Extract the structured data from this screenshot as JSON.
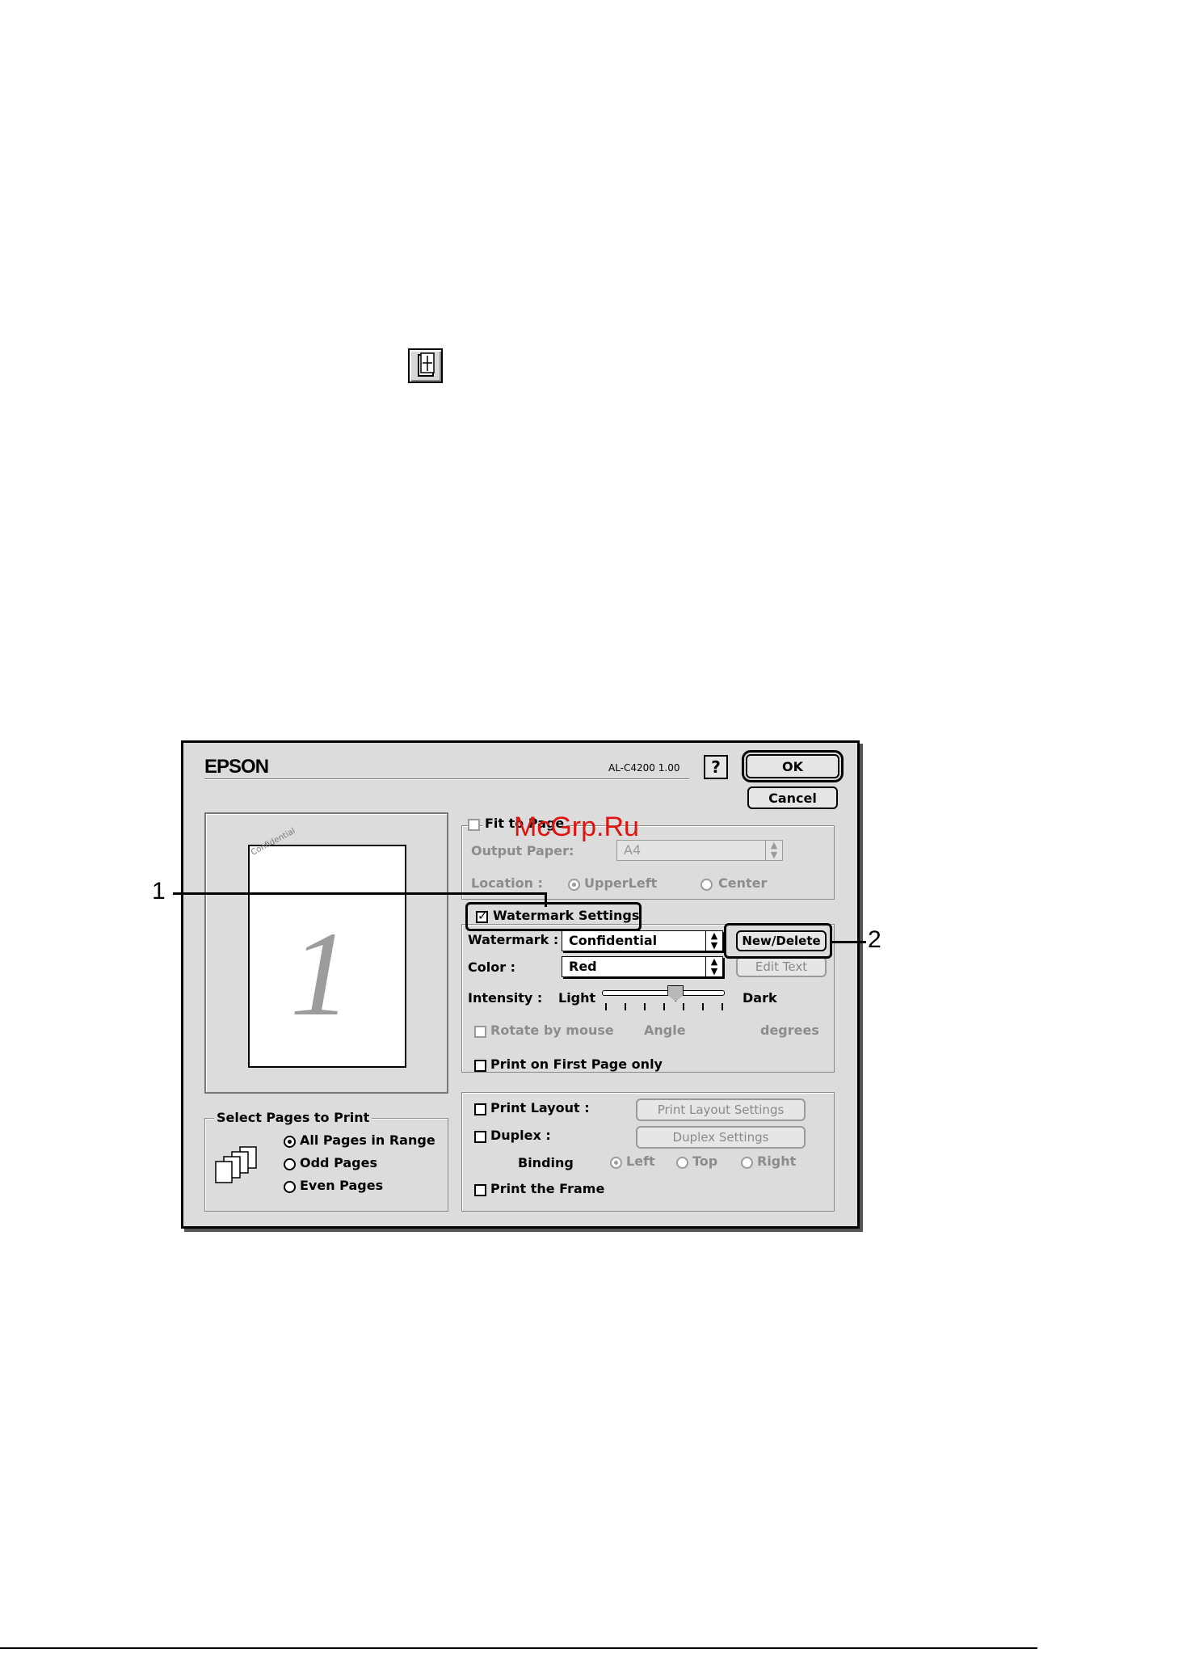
{
  "dialog": {
    "brand": "EPSON",
    "model": "AL-C4200 1.00",
    "help_label": "?",
    "ok_label": "OK",
    "cancel_label": "Cancel"
  },
  "preview": {
    "page_number": "1",
    "watermark_sample": "Confidential"
  },
  "fit_to_page": {
    "checkbox_label": "Fit to Page",
    "output_paper_label": "Output Paper:",
    "output_paper_value": "A4",
    "location_label": "Location :",
    "location_options": [
      "UpperLeft",
      "Center"
    ],
    "location_selected": "UpperLeft"
  },
  "watermark": {
    "checkbox_label": "Watermark Settings",
    "checked": true,
    "watermark_label": "Watermark :",
    "watermark_value": "Confidential",
    "new_delete_label": "New/Delete",
    "color_label": "Color :",
    "color_value": "Red",
    "edit_text_label": "Edit Text",
    "intensity_label": "Intensity :",
    "intensity_light": "Light",
    "intensity_dark": "Dark",
    "intensity_level": 0.6,
    "rotate_label": "Rotate by mouse",
    "angle_label": "Angle",
    "degrees_label": "degrees",
    "first_page_label": "Print on First Page only"
  },
  "layout": {
    "print_layout_label": "Print Layout :",
    "print_layout_settings_label": "Print Layout Settings",
    "duplex_label": "Duplex :",
    "duplex_settings_label": "Duplex Settings",
    "binding_label": "Binding",
    "binding_options": [
      "Left",
      "Top",
      "Right"
    ],
    "binding_selected": "Left",
    "print_frame_label": "Print the Frame"
  },
  "pages": {
    "group_label": "Select Pages to Print",
    "options": [
      "All Pages in Range",
      "Odd Pages",
      "Even Pages"
    ],
    "selected": "All Pages in Range"
  },
  "callouts": {
    "one": "1",
    "two": "2"
  },
  "site_watermark": "McGrp.Ru"
}
